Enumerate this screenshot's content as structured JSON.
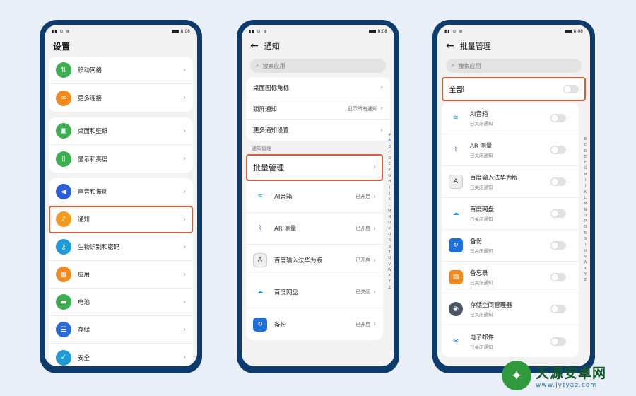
{
  "status_bar": {
    "left": "▮▮ ⊙ ⊛",
    "time": "8:08"
  },
  "phone1": {
    "title": "设置",
    "group1": [
      {
        "label": "移动网络",
        "icon": "signal-icon",
        "color": "#3cae4f"
      },
      {
        "label": "更多连接",
        "icon": "link-icon",
        "color": "#f08a1e"
      }
    ],
    "group2": [
      {
        "label": "桌面和壁纸",
        "icon": "picture-icon",
        "color": "#3cae4f"
      },
      {
        "label": "显示和亮度",
        "icon": "phone-display-icon",
        "color": "#3cae4f"
      }
    ],
    "group3": [
      {
        "label": "声音和振动",
        "icon": "speaker-icon",
        "color": "#2b5fd9"
      },
      {
        "label": "通知",
        "icon": "bell-icon",
        "color": "#f29a1e"
      },
      {
        "label": "生物识别和密码",
        "icon": "key-icon",
        "color": "#1e9ad6"
      },
      {
        "label": "应用",
        "icon": "apps-grid-icon",
        "color": "#f08a1e"
      },
      {
        "label": "电池",
        "icon": "battery-icon",
        "color": "#3cae4f"
      },
      {
        "label": "存储",
        "icon": "storage-icon",
        "color": "#2b6ad9"
      },
      {
        "label": "安全",
        "icon": "shield-icon",
        "color": "#1e9ad6"
      }
    ]
  },
  "phone2": {
    "title": "通知",
    "search_placeholder": "搜索应用",
    "rows": [
      {
        "label": "桌面图标角标",
        "value": ""
      },
      {
        "label": "锁屏通知",
        "value": "显示所有通知"
      },
      {
        "label": "更多通知设置",
        "value": ""
      }
    ],
    "section": "通知管理",
    "batch": "批量管理",
    "apps": [
      {
        "name": "AI音箱",
        "status": "已开启",
        "icon": "voice-wave-icon"
      },
      {
        "name": "AR 测量",
        "status": "已开启",
        "icon": "ruler-icon"
      },
      {
        "name": "百度输入法华为版",
        "status": "已开启",
        "icon": "keyboard-a-icon"
      },
      {
        "name": "百度网盘",
        "status": "已关闭",
        "icon": "cloud-icon"
      },
      {
        "name": "备份",
        "status": "已开启",
        "icon": "backup-icon"
      }
    ],
    "index": [
      "#",
      "A",
      "B",
      "C",
      "D",
      "E",
      "F",
      "G",
      "H",
      "I",
      "J",
      "K",
      "L",
      "M",
      "N",
      "O",
      "P",
      "Q",
      "R",
      "S",
      "T",
      "U",
      "V",
      "W",
      "X",
      "Y",
      "Z"
    ]
  },
  "phone3": {
    "title": "批量管理",
    "search_placeholder": "搜索应用",
    "all_label": "全部",
    "apps": [
      {
        "name": "AI音箱",
        "status": "已关闭通知",
        "icon": "voice-wave-icon"
      },
      {
        "name": "AR 测量",
        "status": "已关闭通知",
        "icon": "ruler-icon"
      },
      {
        "name": "百度输入法华为版",
        "status": "已关闭通知",
        "icon": "keyboard-a-icon"
      },
      {
        "name": "百度网盘",
        "status": "已关闭通知",
        "icon": "cloud-icon"
      },
      {
        "name": "备份",
        "status": "已关闭通知",
        "icon": "backup-icon"
      },
      {
        "name": "备忘录",
        "status": "已关闭通知",
        "icon": "memo-icon"
      },
      {
        "name": "存储空间管理器",
        "status": "已关闭通知",
        "icon": "storage-manager-icon"
      },
      {
        "name": "电子邮件",
        "status": "已关闭通知",
        "icon": "mail-icon"
      }
    ],
    "index": [
      "B",
      "C",
      "D",
      "E",
      "F",
      "G",
      "H",
      "I",
      "J",
      "K",
      "L",
      "M",
      "N",
      "O",
      "P",
      "Q",
      "R",
      "S",
      "T",
      "U",
      "V",
      "W",
      "X",
      "Y",
      "Z"
    ]
  },
  "watermark": {
    "name": "天源安卓网",
    "url": "www.jytyaz.com"
  }
}
